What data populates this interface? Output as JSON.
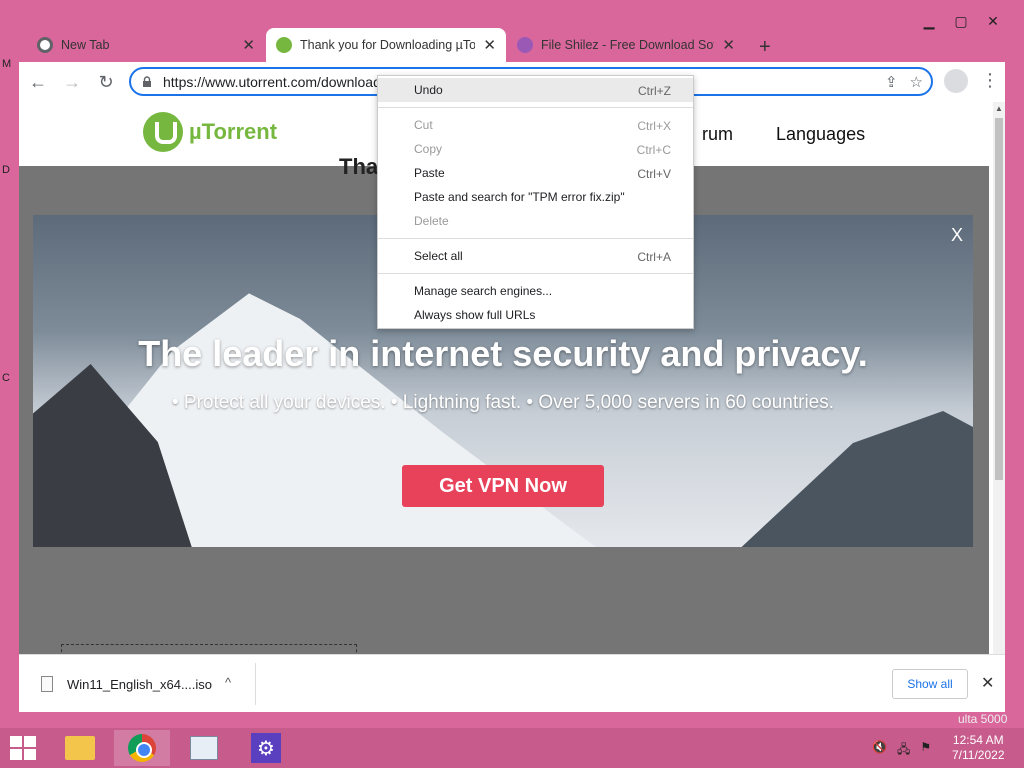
{
  "desktop": {
    "fragments": [
      "M",
      "D",
      "C"
    ],
    "peek_text": "ulta 5000"
  },
  "window": {
    "controls": {
      "minimize": "▁",
      "maximize": "▢",
      "close": "✕"
    }
  },
  "tabs": [
    {
      "title": "New Tab",
      "favicon_color": "#5f6368",
      "active": false
    },
    {
      "title": "Thank you for Downloading µTorrent",
      "favicon_color": "#76b83f",
      "active": true
    },
    {
      "title": "File Shilez - Free Download Software",
      "favicon_color": "#9b59b6",
      "active": false
    }
  ],
  "new_tab_label": "+",
  "toolbar": {
    "back": "←",
    "forward": "→",
    "reload": "↻",
    "url": "https://www.utorrent.com/downloads/complete/track/stable/os/win/",
    "share": "⇪",
    "bookmark": "☆",
    "menu": "⋮"
  },
  "site": {
    "logo_text": "µTorrent",
    "brand_color": "#76b83f",
    "nav": [
      {
        "label": "rum"
      },
      {
        "label": "Languages"
      }
    ],
    "hidden_title": "Tha"
  },
  "promo": {
    "close": "X",
    "title": "The leader in internet security and privacy.",
    "subtitle": "• Protect all your devices.  • Lightning fast. • Over 5,000 servers in 60 countries.",
    "cta": "Get VPN Now",
    "cta_color": "#e8425a"
  },
  "scrollbar": {
    "up": "▲",
    "down": "▼"
  },
  "context_menu": {
    "groups": [
      [
        {
          "label": "Undo",
          "shortcut": "Ctrl+Z",
          "disabled": false,
          "highlight": true
        }
      ],
      [
        {
          "label": "Cut",
          "shortcut": "Ctrl+X",
          "disabled": true
        },
        {
          "label": "Copy",
          "shortcut": "Ctrl+C",
          "disabled": true
        },
        {
          "label": "Paste",
          "shortcut": "Ctrl+V",
          "disabled": false
        },
        {
          "label": "Paste and search for \"TPM error fix.zip\"",
          "shortcut": "",
          "disabled": false
        },
        {
          "label": "Delete",
          "shortcut": "",
          "disabled": true
        }
      ],
      [
        {
          "label": "Select all",
          "shortcut": "Ctrl+A",
          "disabled": false
        }
      ],
      [
        {
          "label": "Manage search engines...",
          "shortcut": "",
          "disabled": false
        },
        {
          "label": "Always show full URLs",
          "shortcut": "",
          "disabled": false
        }
      ]
    ]
  },
  "download_shelf": {
    "file_name": "Win11_English_x64....iso",
    "chevron": "^",
    "show_all": "Show all",
    "close": "✕"
  },
  "taskbar": {
    "clock_time": "12:54 AM",
    "clock_date": "7/11/2022",
    "tray_icons": [
      "speaker-muted-icon",
      "network-icon",
      "flag-icon"
    ],
    "settings_glyph": "⚙"
  }
}
